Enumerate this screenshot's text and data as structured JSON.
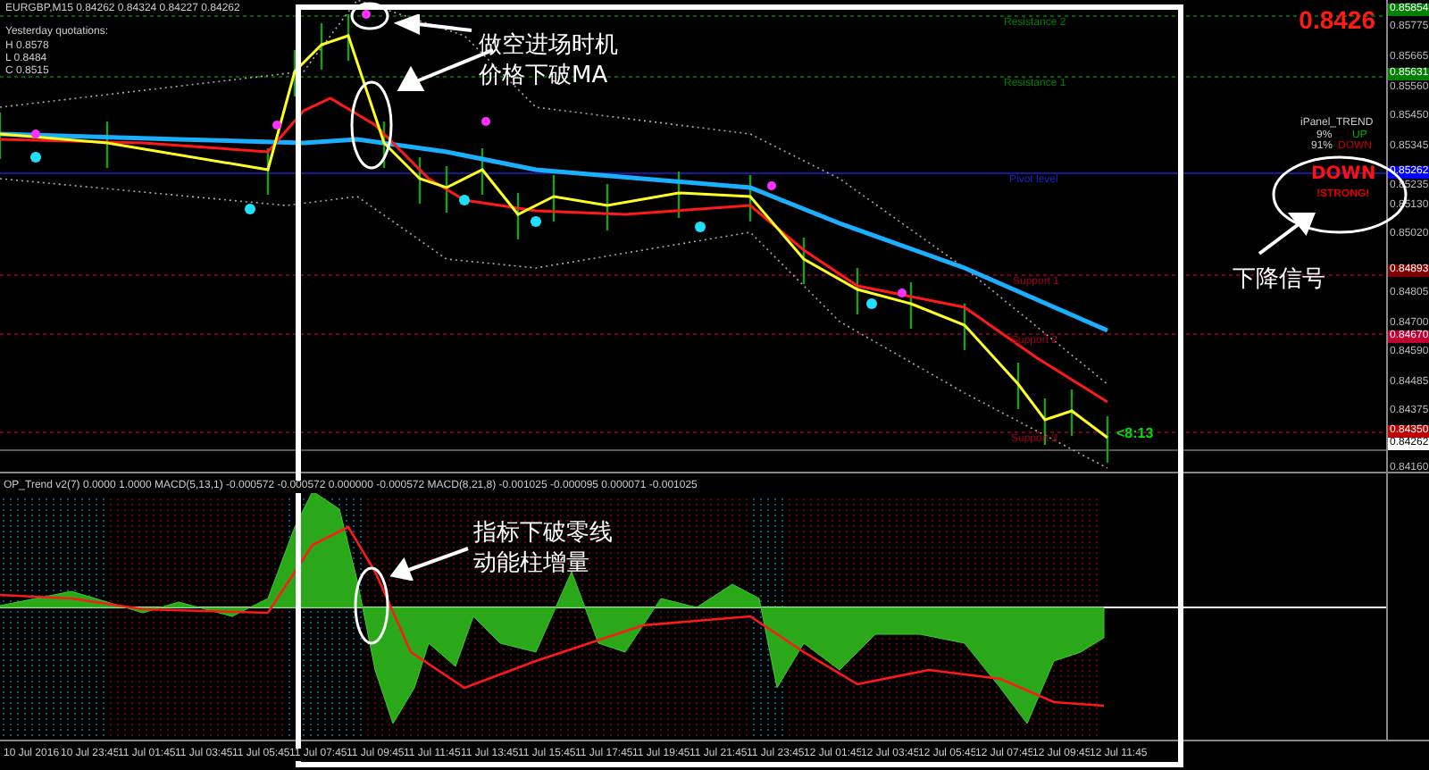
{
  "symbol_header": "EURGBP,M15  0.84262 0.84324 0.84227 0.84262",
  "yesterday": {
    "title": "Yesterday quotations:",
    "lines": [
      "H 0.8578",
      "L 0.8484",
      "C 0.8515"
    ]
  },
  "levels": [
    {
      "label": "Resistance 2",
      "kind": "resistance"
    },
    {
      "label": "Resistance 1",
      "kind": "resistance"
    },
    {
      "label": "Pivot level",
      "kind": "pivot"
    },
    {
      "label": "Support 1",
      "kind": "support"
    },
    {
      "label": "Support 2",
      "kind": "support"
    },
    {
      "label": "Support 3",
      "kind": "support"
    }
  ],
  "current_price": "0.8426",
  "countdown": "<8:13",
  "trend_panel": {
    "title": "iPanel_TREND",
    "up_pct": "9%",
    "up_label": "UP",
    "down_pct": "91%",
    "down_label": "DOWN",
    "signal": "DOWN",
    "strength": "!STRONG!"
  },
  "price_axis": [
    {
      "value": "0.85854",
      "kind": "tag",
      "color": "#008000"
    },
    {
      "value": "0.85775",
      "kind": "tick"
    },
    {
      "value": "0.85665",
      "kind": "tick"
    },
    {
      "value": "0.85631",
      "kind": "tag",
      "color": "#008000"
    },
    {
      "value": "0.85560",
      "kind": "tick"
    },
    {
      "value": "0.85450",
      "kind": "tick"
    },
    {
      "value": "0.85345",
      "kind": "tick"
    },
    {
      "value": "0.85262",
      "kind": "tag",
      "color": "#0000ff"
    },
    {
      "value": "0.85235",
      "kind": "tick"
    },
    {
      "value": "0.85130",
      "kind": "tick"
    },
    {
      "value": "0.85020",
      "kind": "tick"
    },
    {
      "value": "0.84893",
      "kind": "tag",
      "color": "#800000"
    },
    {
      "value": "0.84805",
      "kind": "tick"
    },
    {
      "value": "0.84700",
      "kind": "tick"
    },
    {
      "value": "0.84670",
      "kind": "tag",
      "color": "#c00030"
    },
    {
      "value": "0.84590",
      "kind": "tick"
    },
    {
      "value": "0.84485",
      "kind": "tick"
    },
    {
      "value": "0.84375",
      "kind": "tick"
    },
    {
      "value": "0.84350",
      "kind": "tag",
      "color": "#c00000"
    },
    {
      "value": "0.84262",
      "kind": "tag",
      "color": "#ffffff"
    },
    {
      "value": "0.84160",
      "kind": "tick"
    }
  ],
  "indicator_header": "OP_Trend v2(7) 0.0000 1.0000  MACD(5,13,1) -0.000572 -0.000572 0.000000 -0.000572  MACD(8,21,8) -0.001025 -0.000095 0.000071 -0.001025",
  "annotations": [
    {
      "lines": [
        "做空进场时机",
        "价格下破MA"
      ]
    },
    {
      "lines": [
        "下降信号"
      ]
    },
    {
      "lines": [
        "指标下破零线",
        "动能柱增量"
      ]
    }
  ],
  "time_axis": [
    "10 Jul 2016",
    "10 Jul 23:45",
    "11 Jul 01:45",
    "11 Jul 03:45",
    "11 Jul 05:45",
    "11 Jul 07:45",
    "11 Jul 09:45",
    "11 Jul 11:45",
    "11 Jul 13:45",
    "11 Jul 15:45",
    "11 Jul 17:45",
    "11 Jul 19:45",
    "11 Jul 21:45",
    "11 Jul 23:45",
    "12 Jul 01:45",
    "12 Jul 03:45",
    "12 Jul 05:45",
    "12 Jul 07:45",
    "12 Jul 09:45",
    "12 Jul 11:45"
  ]
}
